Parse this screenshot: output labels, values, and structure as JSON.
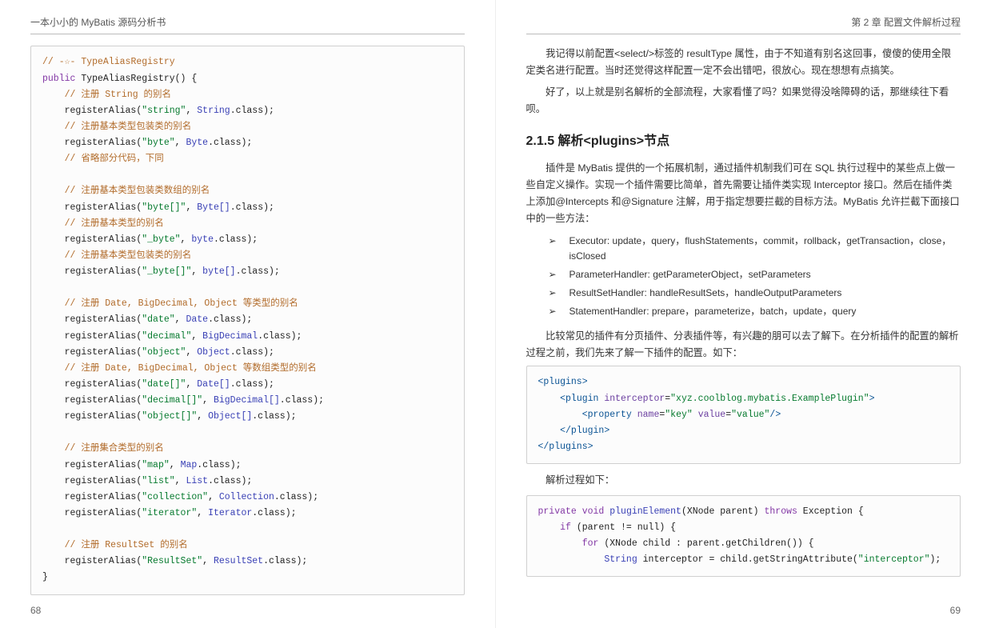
{
  "left": {
    "header": "一本小小的 MyBatis 源码分析书",
    "pageno": "68",
    "code": {
      "l1_comment": "// -☆- TypeAliasRegistry",
      "l2_kw": "public",
      "l2_rest": " TypeAliasRegistry() {",
      "l3_comment": "// 注册 String 的别名",
      "l4_call": "registerAlias(",
      "l4_s": "\"string\"",
      "l4_sep": ", ",
      "l4_cls": "String",
      "l4_end": ".class);",
      "l5_comment": "// 注册基本类型包装类的别名",
      "l6_s": "\"byte\"",
      "l6_cls": "Byte",
      "l7_comment": "// 省略部分代码，下同",
      "blk2_comment": "// 注册基本类型包装类数组的别名",
      "blk2_s": "\"byte[]\"",
      "blk2_cls": "Byte[]",
      "blk3_comment": "// 注册基本类型的别名",
      "blk3_s": "\"_byte\"",
      "blk3_cls": "byte",
      "blk4_comment": "// 注册基本类型包装类的别名",
      "blk4_s": "\"_byte[]\"",
      "blk4_cls": "byte[]",
      "blk5_comment": "// 注册 Date, BigDecimal, Object 等类型的别名",
      "b5a_s": "\"date\"",
      "b5a_cls": "Date",
      "b5b_s": "\"decimal\"",
      "b5b_cls": "BigDecimal",
      "b5c_s": "\"object\"",
      "b5c_cls": "Object",
      "blk6_comment": "// 注册 Date, BigDecimal, Object 等数组类型的别名",
      "b6a_s": "\"date[]\"",
      "b6a_cls": "Date[]",
      "b6b_s": "\"decimal[]\"",
      "b6b_cls": "BigDecimal[]",
      "b6c_s": "\"object[]\"",
      "b6c_cls": "Object[]",
      "blk7_comment": "// 注册集合类型的别名",
      "b7a_s": "\"map\"",
      "b7a_cls": "Map",
      "b7b_s": "\"list\"",
      "b7b_cls": "List",
      "b7c_s": "\"collection\"",
      "b7c_cls": "Collection",
      "b7d_s": "\"iterator\"",
      "b7d_cls": "Iterator",
      "blk8_comment": "// 注册 ResultSet 的别名",
      "b8_s": "\"ResultSet\"",
      "b8_cls": "ResultSet",
      "close": "}"
    }
  },
  "right": {
    "header": "第 2 章 配置文件解析过程",
    "pageno": "69",
    "p1": "我记得以前配置<select/>标签的 resultType 属性，由于不知道有别名这回事，傻傻的使用全限定类名进行配置。当时还觉得这样配置一定不会出错吧，很放心。现在想想有点搞笑。",
    "p2": "好了，以上就是别名解析的全部流程，大家看懂了吗？如果觉得没啥障碍的话，那继续往下看呗。",
    "section": "2.1.5 解析<plugins>节点",
    "p3": "插件是 MyBatis 提供的一个拓展机制，通过插件机制我们可在 SQL 执行过程中的某些点上做一些自定义操作。实现一个插件需要比简单，首先需要让插件类实现 Interceptor 接口。然后在插件类上添加@Intercepts 和@Signature 注解，用于指定想要拦截的目标方法。MyBatis 允许拦截下面接口中的一些方法：",
    "bullets": {
      "arrow": "➢",
      "b1": "Executor: update，query，flushStatements，commit，rollback，getTransaction，close，isClosed",
      "b2": "ParameterHandler: getParameterObject，setParameters",
      "b3": "ResultSetHandler: handleResultSets，handleOutputParameters",
      "b4": "StatementHandler: prepare，parameterize，batch，update，query"
    },
    "p4": "比较常见的插件有分页插件、分表插件等，有兴趣的朋可以去了解下。在分析插件的配置的解析过程之前，我们先来了解一下插件的配置。如下：",
    "xml": {
      "t_plugins_o": "<plugins>",
      "t_plugin_o": "<plugin",
      "a_interceptor": "interceptor",
      "v_interceptor": "\"xyz.coolblog.mybatis.ExamplePlugin\"",
      "t_plugin_c": ">",
      "t_prop_o": "<property",
      "a_name": "name",
      "v_name": "\"key\"",
      "a_value": "value",
      "v_value": "\"value\"",
      "t_prop_c": "/>",
      "t_plugin_close": "</plugin>",
      "t_plugins_close": "</plugins>"
    },
    "p5": "解析过程如下：",
    "java": {
      "kw_private": "private",
      "kw_void": "void",
      "fn": "pluginElement",
      "sig_open": "(XNode parent) ",
      "kw_throws": "throws",
      "sig_rest": " Exception {",
      "l2_kw_if": "if",
      "l2_rest": " (parent != null) {",
      "l3_kw_for": "for",
      "l3_rest": " (XNode child : parent.getChildren()) {",
      "l4_type": "String",
      "l4_mid": " interceptor = child.getStringAttribute(",
      "l4_str": "\"interceptor\"",
      "l4_end": ");"
    }
  }
}
